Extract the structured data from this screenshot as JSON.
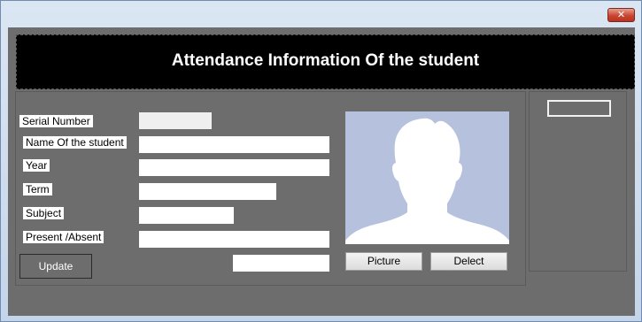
{
  "window": {
    "close_glyph": "✕"
  },
  "header": {
    "title": "Attendance Information Of the student"
  },
  "form": {
    "labels": {
      "serial_number": "Serial Number",
      "name": "Name Of the student",
      "year": "Year",
      "term": "Term",
      "subject": "Subject",
      "present_absent": "Present /Absent"
    },
    "values": {
      "serial_number": "",
      "name": "",
      "year": "",
      "term": "",
      "subject": "",
      "present_absent": "",
      "extra": ""
    }
  },
  "buttons": {
    "update": "Update",
    "picture": "Picture",
    "delect": "Delect"
  },
  "photo": {
    "icon": "person-silhouette-icon",
    "background_color": "#b6c1dd"
  },
  "colors": {
    "form_background": "#6d6d6d",
    "banner_background": "#000000",
    "close_button": "#c94532"
  }
}
